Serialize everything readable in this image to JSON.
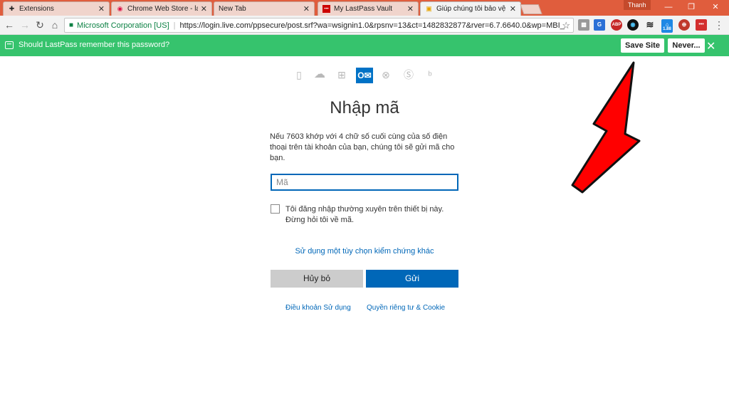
{
  "browser": {
    "tabs": [
      {
        "title": "Extensions",
        "icon": "puzzle-icon"
      },
      {
        "title": "Chrome Web Store - lastp",
        "icon": "chrome-store-icon"
      },
      {
        "title": "New Tab",
        "icon": "none"
      },
      {
        "title": "My LastPass Vault",
        "icon": "lastpass-icon"
      },
      {
        "title": "Giúp chúng tôi bảo vệ tài",
        "icon": "microsoft-icon"
      }
    ],
    "user_name": "Thanh",
    "omnibox": {
      "org": "Microsoft Corporation [US]",
      "url": "https://login.live.com/ppsecure/post.srf?wa=wsignin1.0&rpsnv=13&ct=1482832877&rver=6.7.6640.0&wp=MBI_"
    },
    "extension_badge": "1.88"
  },
  "lastpass_bar": {
    "message": "Should LastPass remember this password?",
    "save_label": "Save Site",
    "never_label": "Never..."
  },
  "page": {
    "heading": "Nhập mã",
    "description": "Nếu 7603 khớp với 4 chữ số cuối cùng của số điện thoại trên tài khoản của bạn, chúng tôi sẽ gửi mã cho bạn.",
    "code_placeholder": "Mã",
    "checkbox_label": "Tôi đăng nhập thường xuyên trên thiết bị này. Đừng hỏi tôi về mã.",
    "alt_link": "Sử dụng một tùy chọn kiểm chứng khác",
    "cancel_label": "Hủy bỏ",
    "send_label": "Gửi",
    "terms_label": "Điều khoản Sử dụng",
    "privacy_label": "Quyền riêng tư & Cookie"
  },
  "colors": {
    "titlebar": "#e05d3d",
    "lastpass_green": "#36c36d",
    "microsoft_blue": "#0067b8",
    "annotation_arrow": "#ff0000"
  }
}
